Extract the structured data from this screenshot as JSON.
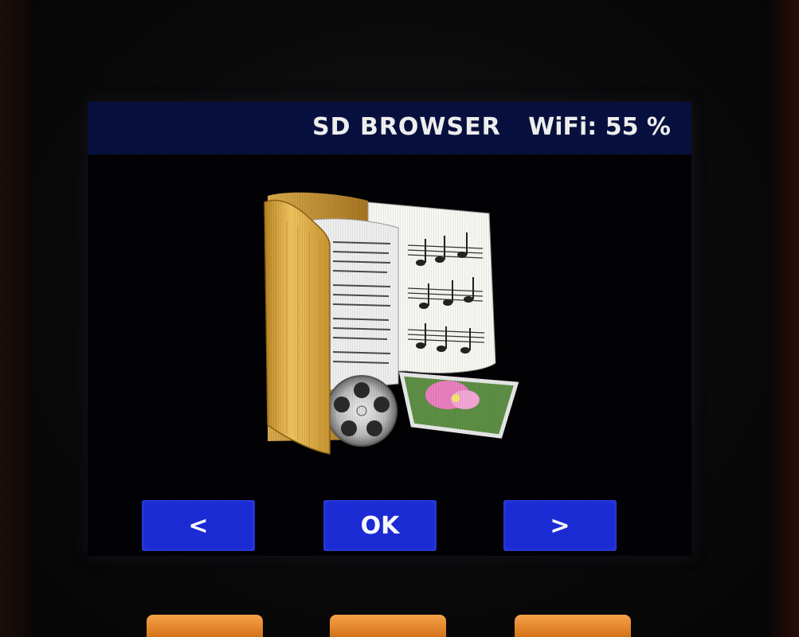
{
  "header": {
    "title": "SD BROWSER",
    "wifi_label": "WiFi:",
    "wifi_value": "55 %"
  },
  "main": {
    "icon": "media-folder-icon"
  },
  "nav": {
    "prev_label": "<",
    "ok_label": "OK",
    "next_label": ">"
  },
  "hardware_buttons": [
    "hw-button-left",
    "hw-button-center",
    "hw-button-right"
  ],
  "colors": {
    "topbar": "#07103f",
    "button": "#1b2cd8",
    "screen_bg": "#020205",
    "hw_button": "#e88a30"
  }
}
